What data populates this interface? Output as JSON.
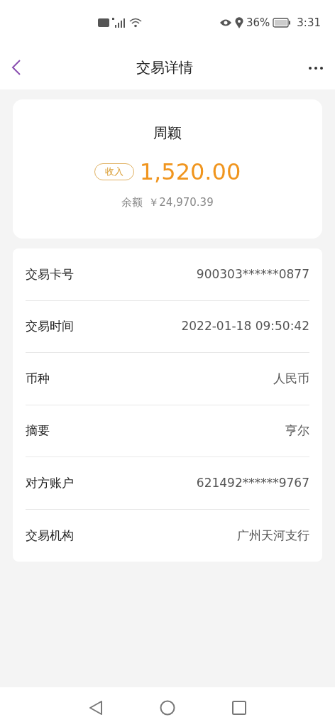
{
  "status_bar": {
    "battery": "36%",
    "time": "3:31"
  },
  "header": {
    "title": "交易详情"
  },
  "summary": {
    "name": "周颖",
    "tag": "收入",
    "amount": "1,520.00",
    "balance_label": "余额",
    "balance": "￥24,970.39"
  },
  "details": [
    {
      "label": "交易卡号",
      "value": "900303******0877"
    },
    {
      "label": "交易时间",
      "value": "2022-01-18 09:50:42"
    },
    {
      "label": "币种",
      "value": "人民币"
    },
    {
      "label": "摘要",
      "value": "亨尔"
    },
    {
      "label": "对方账户",
      "value": "621492******9767"
    },
    {
      "label": "交易机构",
      "value": "广州天河支行"
    }
  ]
}
